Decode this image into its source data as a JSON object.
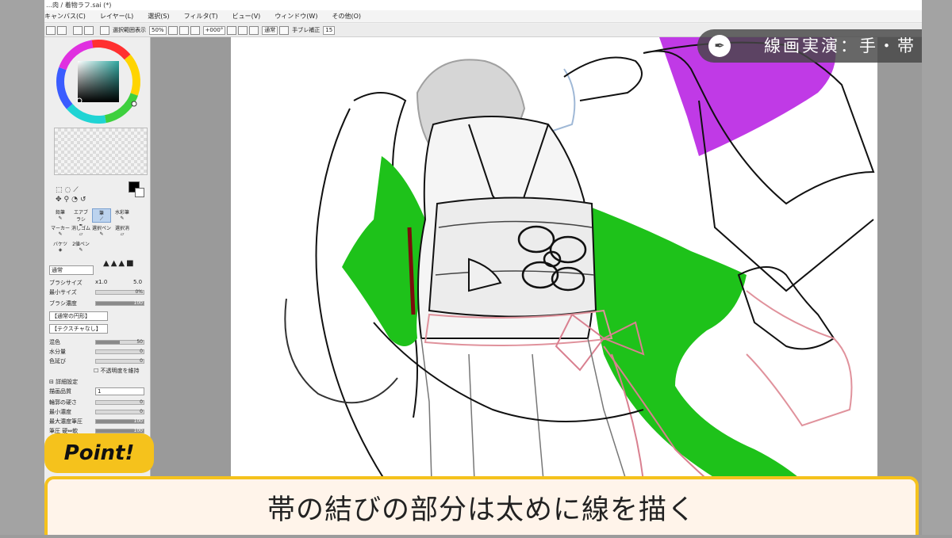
{
  "window": {
    "title": "…肉 / 着物ラフ.sai (*)"
  },
  "menu": [
    "キャンバス(C)",
    "レイヤー(L)",
    "選択(S)",
    "フィルタ(T)",
    "ビュー(V)",
    "ウィンドウ(W)",
    "その他(O)"
  ],
  "toolbar": {
    "stabilizer_check_label": "選択範囲表示",
    "zoom": "50%",
    "rotation": "+000°",
    "blend_mode": "通常",
    "stabilizer_label": "手ブレ補正",
    "stabilizer_value": "15"
  },
  "brush_panel": {
    "tools": [
      "鉛筆",
      "エアブラシ",
      "筆",
      "水彩筆",
      "マーカー",
      "消しゴム",
      "選択ペン",
      "選択消",
      "バケツ",
      "2値ペン"
    ],
    "mode_label": "通常",
    "brush_size_label": "ブラシサイズ",
    "brush_size_mult": "x1.0",
    "brush_size_value": "5.0",
    "min_size_label": "最小サイズ",
    "min_size_value": "0%",
    "density_label": "ブラシ濃度",
    "density_value": "100",
    "shape_label": "【通常の円形】",
    "texture_label": "【テクスチャなし】",
    "blend_label": "混色",
    "blend_value": "50",
    "water_label": "水分量",
    "water_value": "0",
    "stretch_label": "色延び",
    "stretch_value": "0",
    "keep_opacity_label": "不透明度を維持",
    "detail_label": "詳細設定",
    "quality_label": "描画品質",
    "quality_value": "1",
    "edge_label": "輪郭の硬さ",
    "edge_value": "0",
    "min_density_label": "最小濃度",
    "min_density_value": "0",
    "max_pressure_label": "最大濃度筆圧",
    "max_pressure_value": "100",
    "pressure_label": "筆圧 硬⇔軟",
    "pressure_value": "100"
  },
  "banner": {
    "icon": "pen-nib-icon",
    "text": "線画実演：手・帯"
  },
  "point_badge": "Point!",
  "caption": "帯の結びの部分は太めに線を描く",
  "colors": {
    "accent_yellow": "#f5c21c",
    "green_fill": "#1ec21a",
    "purple_fill": "#c03ae6",
    "sketch_red": "#e4a0a8",
    "primary_color": "#000000"
  }
}
